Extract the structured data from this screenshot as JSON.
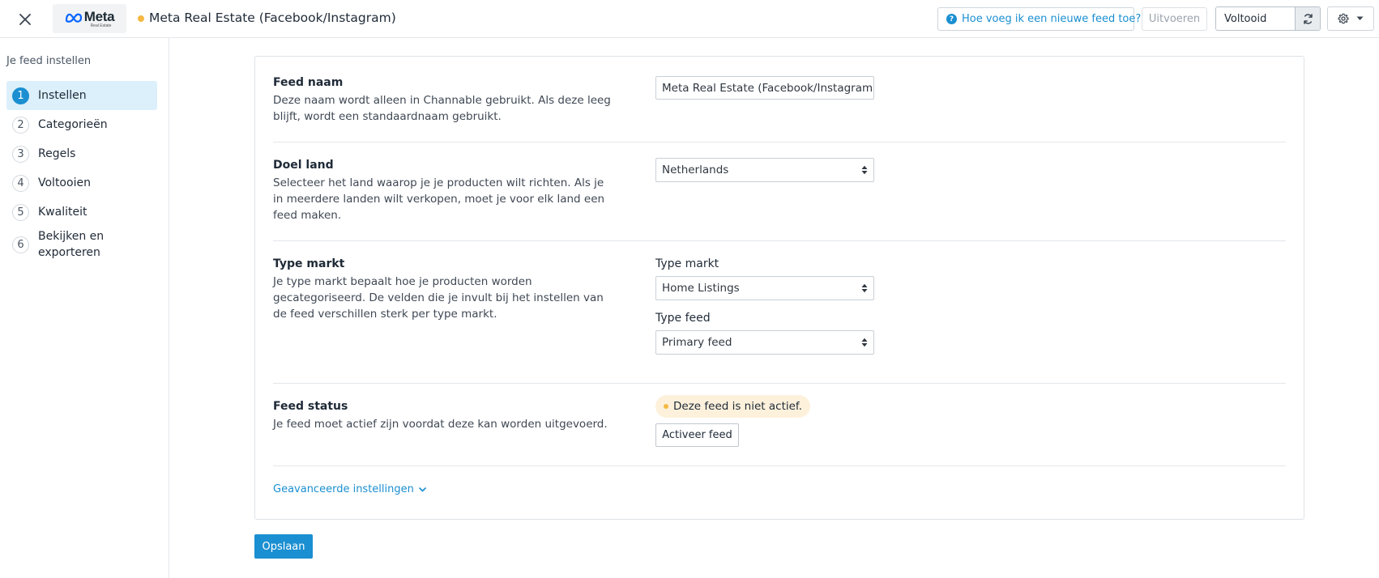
{
  "header": {
    "logo": {
      "text": "Meta",
      "sub": "Real Estate"
    },
    "feed_title": "Meta Real Estate (Facebook/Instagram)",
    "help_label": "Hoe voeg ik een nieuwe feed toe?",
    "run_label": "Uitvoeren",
    "status_label": "Voltooid",
    "icons": [
      "close-icon",
      "help-icon",
      "sync-icon",
      "gear-icon",
      "caret-down-icon"
    ]
  },
  "sidebar": {
    "title": "Je feed instellen",
    "steps": [
      {
        "num": "1",
        "label": "Instellen",
        "active": true
      },
      {
        "num": "2",
        "label": "Categorieën",
        "active": false
      },
      {
        "num": "3",
        "label": "Regels",
        "active": false
      },
      {
        "num": "4",
        "label": "Voltooien",
        "active": false
      },
      {
        "num": "5",
        "label": "Kwaliteit",
        "active": false
      },
      {
        "num": "6",
        "label": "Bekijken en exporteren",
        "active": false
      }
    ]
  },
  "main": {
    "feed_name": {
      "title": "Feed naam",
      "description": "Deze naam wordt alleen in Channable gebruikt. Als deze leeg blijft, wordt een standaardnaam gebruikt.",
      "value": "Meta Real Estate (Facebook/Instagram)"
    },
    "target_country": {
      "title": "Doel land",
      "description": "Selecteer het land waarop je je producten wilt richten. Als je in meerdere landen wilt verkopen, moet je voor elk land een feed maken.",
      "value": "Netherlands"
    },
    "market_type": {
      "title": "Type markt",
      "description": "Je type markt bepaalt hoe je producten worden gecategoriseerd. De velden die je invult bij het instellen van de feed verschillen sterk per type markt.",
      "market_label": "Type markt",
      "market_value": "Home Listings",
      "feed_type_label": "Type feed",
      "feed_type_value": "Primary feed"
    },
    "feed_status": {
      "title": "Feed status",
      "description": "Je feed moet actief zijn voordat deze kan worden uitgevoerd.",
      "badge": "Deze feed is niet actief.",
      "activate_label": "Activeer feed"
    },
    "advanced_label": "Geavanceerde instellingen",
    "save_label": "Opslaan"
  },
  "colors": {
    "accent": "#1a8fd1",
    "status_dot": "#f5b942",
    "active_step_bg": "#dcf0fb",
    "badge_bg": "#fdf1dc"
  }
}
